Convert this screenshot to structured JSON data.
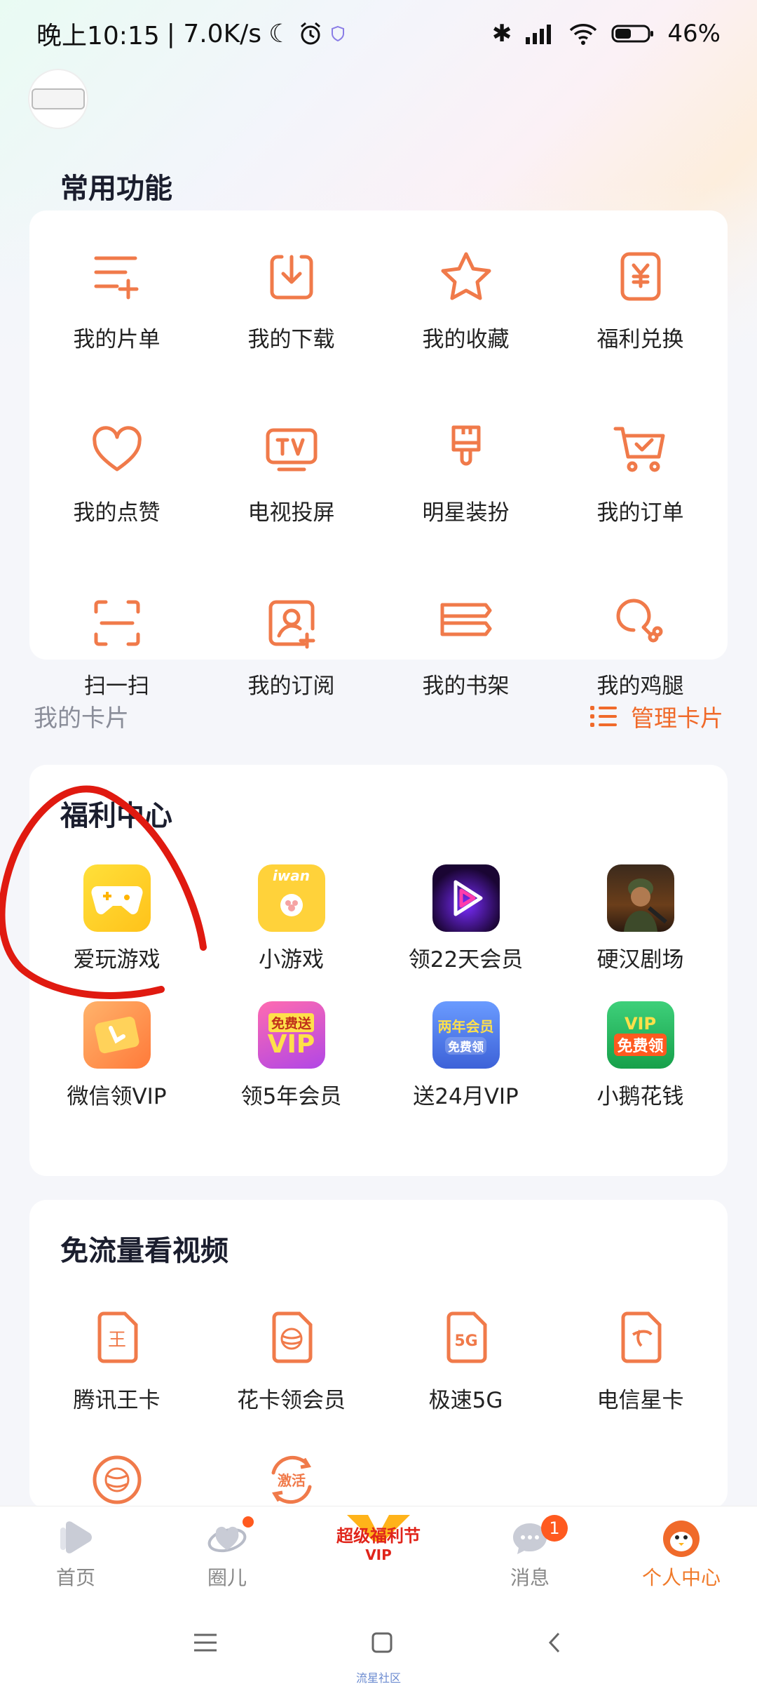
{
  "status_bar": {
    "time": "晚上10:15",
    "speed": "| 7.0K/s",
    "battery": "46%"
  },
  "common": {
    "title": "常用功能",
    "items": [
      {
        "label": "我的片单",
        "icon": "playlist-add-icon"
      },
      {
        "label": "我的下载",
        "icon": "download-icon"
      },
      {
        "label": "我的收藏",
        "icon": "star-icon"
      },
      {
        "label": "福利兑换",
        "icon": "yen-coupon-icon"
      },
      {
        "label": "我的点赞",
        "icon": "heart-icon"
      },
      {
        "label": "电视投屏",
        "icon": "tv-cast-icon"
      },
      {
        "label": "明星装扮",
        "icon": "paint-brush-icon"
      },
      {
        "label": "我的订单",
        "icon": "cart-icon"
      },
      {
        "label": "扫一扫",
        "icon": "scan-icon"
      },
      {
        "label": "我的订阅",
        "icon": "subscribe-user-icon"
      },
      {
        "label": "我的书架",
        "icon": "bookshelf-icon"
      },
      {
        "label": "我的鸡腿",
        "icon": "drumstick-icon"
      }
    ]
  },
  "cards_header": {
    "title": "我的卡片",
    "manage": "管理卡片"
  },
  "welfare": {
    "title": "福利中心",
    "items": [
      {
        "label": "爱玩游戏",
        "icon": "game-controller-app-icon"
      },
      {
        "label": "小游戏",
        "icon": "iwan-cat-app-icon",
        "badge_text": "iwan"
      },
      {
        "label": "领22天会员",
        "icon": "video-play-app-icon"
      },
      {
        "label": "硬汉剧场",
        "icon": "soldier-app-icon"
      },
      {
        "label": "微信领VIP",
        "icon": "vip-ticket-app-icon"
      },
      {
        "label": "领5年会员",
        "icon": "free-vip-app-icon",
        "line1": "免费送",
        "line2": "VIP"
      },
      {
        "label": "送24月VIP",
        "icon": "two-year-member-app-icon",
        "line1": "两年会员",
        "line2": "免费领"
      },
      {
        "label": "小鹅花钱",
        "icon": "vip-free-app-icon",
        "line1": "VIP",
        "line2": "免费领"
      }
    ]
  },
  "free_data": {
    "title": "免流量看视频",
    "items": [
      {
        "label": "腾讯王卡",
        "icon": "sim-card-wang-icon",
        "glyph": "王"
      },
      {
        "label": "花卡领会员",
        "icon": "sim-card-globe-icon"
      },
      {
        "label": "极速5G",
        "icon": "sim-card-5g-icon",
        "glyph": "5G"
      },
      {
        "label": "电信星卡",
        "icon": "sim-card-telecom-icon"
      },
      {
        "label": "",
        "icon": "globe-circle-icon"
      },
      {
        "label": "",
        "icon": "activate-icon",
        "glyph": "激活"
      }
    ]
  },
  "tabs": [
    {
      "label": "首页",
      "icon": "home-play-icon"
    },
    {
      "label": "圈儿",
      "icon": "circle-heart-icon"
    },
    {
      "label": "",
      "icon": "super-welfare-festival-icon",
      "line1": "超级福利节",
      "line2": "VIP"
    },
    {
      "label": "消息",
      "icon": "message-icon",
      "badge": "1"
    },
    {
      "label": "个人中心",
      "icon": "profile-penguin-icon"
    }
  ],
  "bottom_caption": "流星社区",
  "colors": {
    "accent": "#f06a2a",
    "accent_light": "#f28a5a"
  }
}
